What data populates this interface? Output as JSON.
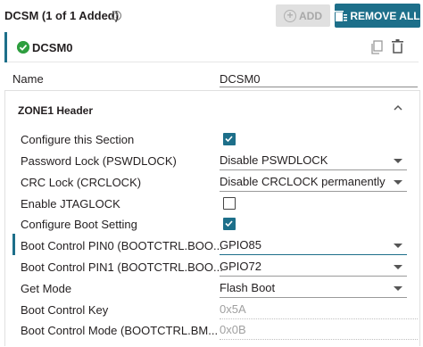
{
  "header": {
    "title": "DCSM (1 of 1 Added)",
    "help_icon": "?",
    "add_label": "ADD",
    "remove_label": "REMOVE ALL"
  },
  "instance": {
    "name": "DCSM0"
  },
  "name_field": {
    "label": "Name",
    "value": "DCSM0"
  },
  "zone": {
    "title": "ZONE1 Header",
    "rows": [
      {
        "label": "Configure this Section",
        "type": "checkbox",
        "checked": true
      },
      {
        "label": "Password Lock (PSWDLOCK)",
        "type": "select",
        "value": "Disable PSWDLOCK"
      },
      {
        "label": "CRC Lock (CRCLOCK)",
        "type": "select",
        "value": "Disable CRCLOCK permanently"
      },
      {
        "label": "Enable JTAGLOCK",
        "type": "checkbox",
        "checked": false
      },
      {
        "label": "Configure Boot Setting",
        "type": "checkbox",
        "checked": true
      },
      {
        "label": "Boot Control PIN0 (BOOTCTRL.BOO...",
        "type": "select",
        "value": "GPIO85"
      },
      {
        "label": "Boot Control PIN1 (BOOTCTRL.BOO...",
        "type": "select",
        "value": "GPIO72"
      },
      {
        "label": "Get Mode",
        "type": "select",
        "value": "Flash Boot"
      },
      {
        "label": "Boot Control Key",
        "type": "readonly",
        "value": "0x5A"
      },
      {
        "label": "Boot Control Mode (BOOTCTRL.BM...",
        "type": "readonly",
        "value": "0x0B"
      }
    ]
  },
  "colors": {
    "accent": "#1d6f8a",
    "success": "#2e9e3f"
  }
}
